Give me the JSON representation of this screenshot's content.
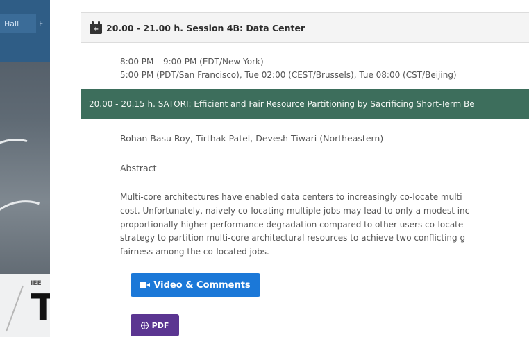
{
  "nav": {
    "item1": "Hall",
    "item2": "F"
  },
  "logo": {
    "small": "IEE",
    "big": "T"
  },
  "session": {
    "icon": "calendar-plus-icon",
    "title": "20.00 - 21.00 h. Session 4B: Data Center",
    "time_line1": "8:00 PM – 9:00 PM (EDT/New York)",
    "time_line2": "5:00 PM (PDT/San Francisco), Tue 02:00 (CEST/Brussels), Tue 08:00 (CST/Beijing)"
  },
  "paper": {
    "title": "20.00 - 20.15 h. SATORI: Efficient and Fair Resource Partitioning by Sacrificing Short-Term Be",
    "authors": "Rohan Basu Roy, Tirthak Patel, Devesh Tiwari (Northeastern)",
    "abstract_label": "Abstract",
    "abstract_lines": [
      "Multi-core architectures have enabled data centers to increasingly co-locate multi",
      "cost. Unfortunately, naively co-locating multiple jobs may lead to only a modest inc",
      "proportionally higher performance degradation compared to other users co-locate",
      "strategy to partition multi-core architectural resources to achieve two conflicting g",
      "fairness among the co-located jobs."
    ]
  },
  "buttons": {
    "video_label": "Video & Comments",
    "video_icon": "video-camera-icon",
    "pdf_label": "PDF",
    "pdf_icon": "globe-icon"
  },
  "colors": {
    "paper_bar": "#3d6e5c",
    "video_button": "#1b78d8",
    "pdf_button": "#5b3591"
  }
}
